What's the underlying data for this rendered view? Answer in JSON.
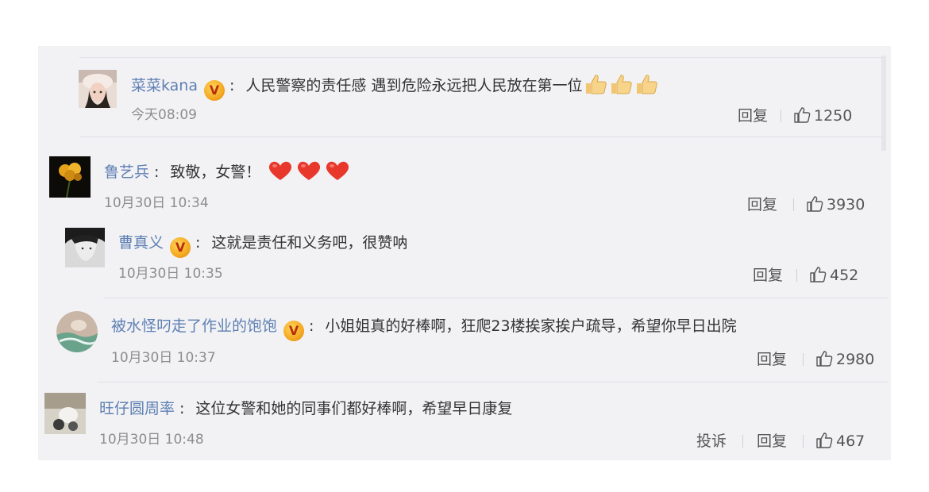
{
  "actions": {
    "reply_label": "回复",
    "report_label": "投诉"
  },
  "colors": {
    "username": "#5d7fb2",
    "timestamp": "#8d8d8d",
    "panel_bg": "#f2f2f5",
    "verified_badge": "#f4a920"
  },
  "comments": [
    {
      "username": "菜菜kana",
      "verified": true,
      "text": "人民警察的责任感 遇到危险永远把人民放在第一位",
      "emoji": [
        "thumbs-up",
        "thumbs-up",
        "thumbs-up"
      ],
      "time": "今天08:09",
      "likes": "1250"
    },
    {
      "username": "鲁艺兵",
      "verified": false,
      "text": "致敬，女警！",
      "emoji": [
        "red-heart",
        "red-heart",
        "red-heart"
      ],
      "time": "10月30日 10:34",
      "likes": "3930"
    },
    {
      "username": "曹真义",
      "verified": true,
      "text": "这就是责任和义务吧，很赞呐",
      "time": "10月30日 10:35",
      "likes": "452"
    },
    {
      "username": "被水怪叼走了作业的饱饱",
      "verified": true,
      "text": "小姐姐真的好棒啊，狂爬23楼挨家挨户疏导，希望你早日出院",
      "time": "10月30日 10:37",
      "likes": "2980"
    },
    {
      "username": "旺仔圆周率",
      "verified": false,
      "text": "这位女警和她的同事们都好棒啊，希望早日康复",
      "time": "10月30日 10:48",
      "likes": "467",
      "has_report": true
    }
  ]
}
